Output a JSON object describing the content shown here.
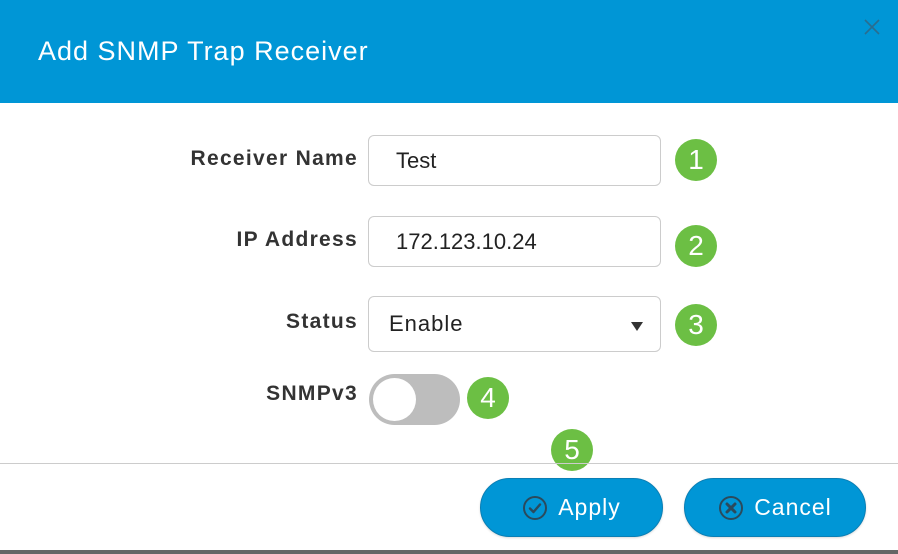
{
  "dialog": {
    "title": "Add SNMP Trap Receiver",
    "close_icon": "close-icon"
  },
  "form": {
    "receiver_name": {
      "label": "Receiver Name",
      "value": "Test",
      "step": "1"
    },
    "ip_address": {
      "label": "IP Address",
      "value": "172.123.10.24",
      "step": "2"
    },
    "status": {
      "label": "Status",
      "selected": "Enable",
      "step": "3"
    },
    "snmpv3": {
      "label": "SNMPv3",
      "enabled": false,
      "step": "4"
    }
  },
  "footer": {
    "apply_label": "Apply",
    "apply_icon": "check-circle-icon",
    "apply_step": "5",
    "cancel_label": "Cancel",
    "cancel_icon": "x-circle-icon"
  },
  "colors": {
    "header": "#0096d6",
    "button": "#0096d6",
    "step_badge": "#6cbf44",
    "toggle_off": "#bdbdbd"
  }
}
